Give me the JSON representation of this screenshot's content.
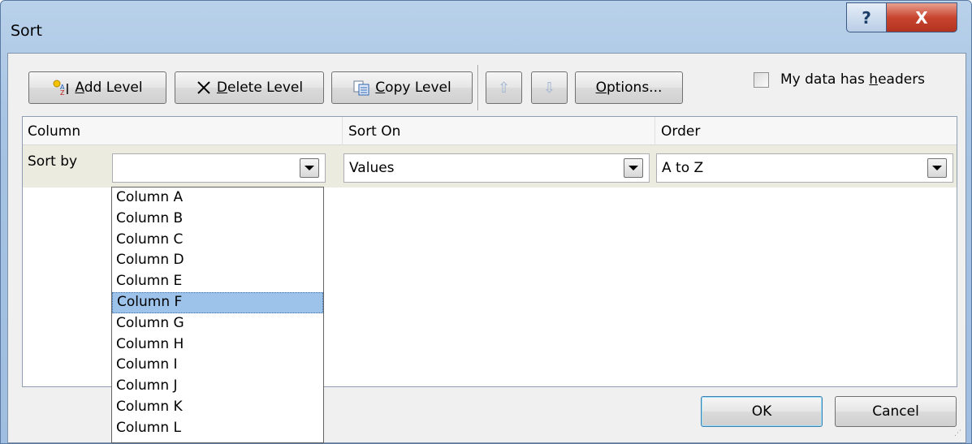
{
  "window": {
    "title": "Sort",
    "help_label": "?",
    "close_label": "X"
  },
  "toolbar": {
    "add_level_prefix": "",
    "add_level_accel": "A",
    "add_level_rest": "dd Level",
    "delete_level_accel": "D",
    "delete_level_rest": "elete Level",
    "copy_level_accel": "C",
    "copy_level_rest": "opy Level",
    "move_up_label": "⇧",
    "move_down_label": "⇩",
    "options_accel": "O",
    "options_rest": "ptions...",
    "headers_label_pre": "My data has ",
    "headers_label_accel": "h",
    "headers_label_post": "eaders",
    "headers_checked": false
  },
  "grid": {
    "headers": {
      "column": "Column",
      "sort_on": "Sort On",
      "order": "Order"
    },
    "rows": [
      {
        "label": "Sort by",
        "column_value": "",
        "sort_on_value": "Values",
        "order_value": "A to Z"
      }
    ]
  },
  "dropdown": {
    "items": [
      "Column A",
      "Column B",
      "Column C",
      "Column D",
      "Column E",
      "Column F",
      "Column G",
      "Column H",
      "Column I",
      "Column J",
      "Column K",
      "Column L"
    ],
    "selected": "Column F"
  },
  "footer": {
    "ok_label": "OK",
    "cancel_label": "Cancel"
  },
  "colors": {
    "selection": "#9ec3eb",
    "close_button": "#c8452f",
    "row_background": "#ecebe0"
  }
}
